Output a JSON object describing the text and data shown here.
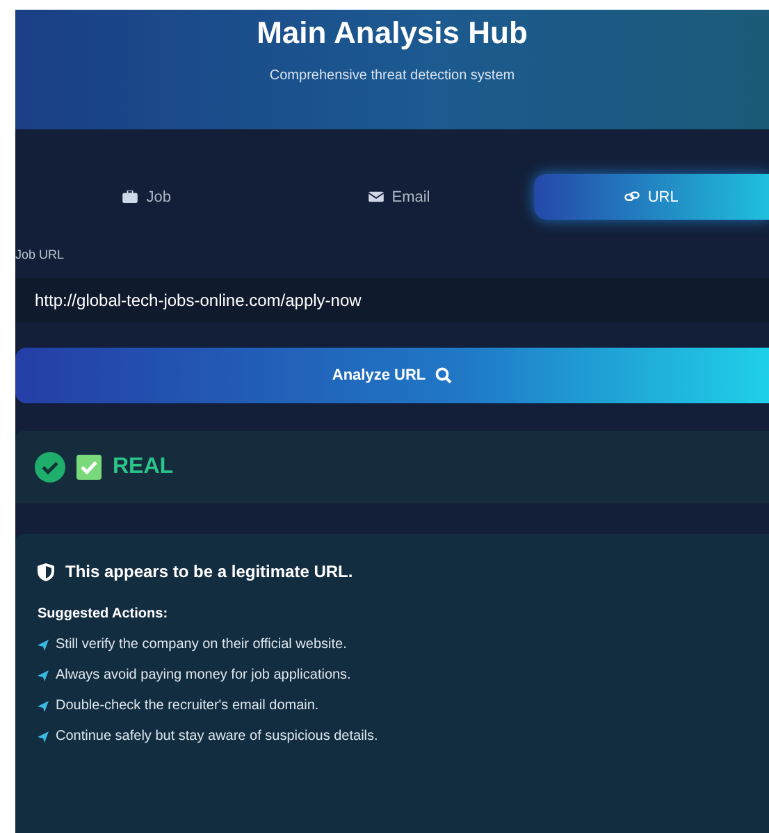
{
  "header": {
    "title": "Main Analysis Hub",
    "subtitle": "Comprehensive threat detection system"
  },
  "tabs": [
    {
      "label": "Job",
      "kind": "job",
      "selected": false
    },
    {
      "label": "Email",
      "kind": "email",
      "selected": false
    },
    {
      "label": "URL",
      "kind": "url",
      "selected": true
    }
  ],
  "field": {
    "label": "Job URL",
    "value": "http://global-tech-jobs-online.com/apply-now"
  },
  "analyze_button": {
    "label": "Analyze URL"
  },
  "verdict": {
    "label": "REAL",
    "kind": "real"
  },
  "details": {
    "message": "This appears to be a legitimate URL.",
    "actions_heading": "Suggested Actions:",
    "actions": [
      "Still verify the company on their official website.",
      "Always avoid paying money for job applications.",
      "Double-check the recruiter's email domain.",
      "Continue safely but stay aware of suspicious details."
    ]
  }
}
